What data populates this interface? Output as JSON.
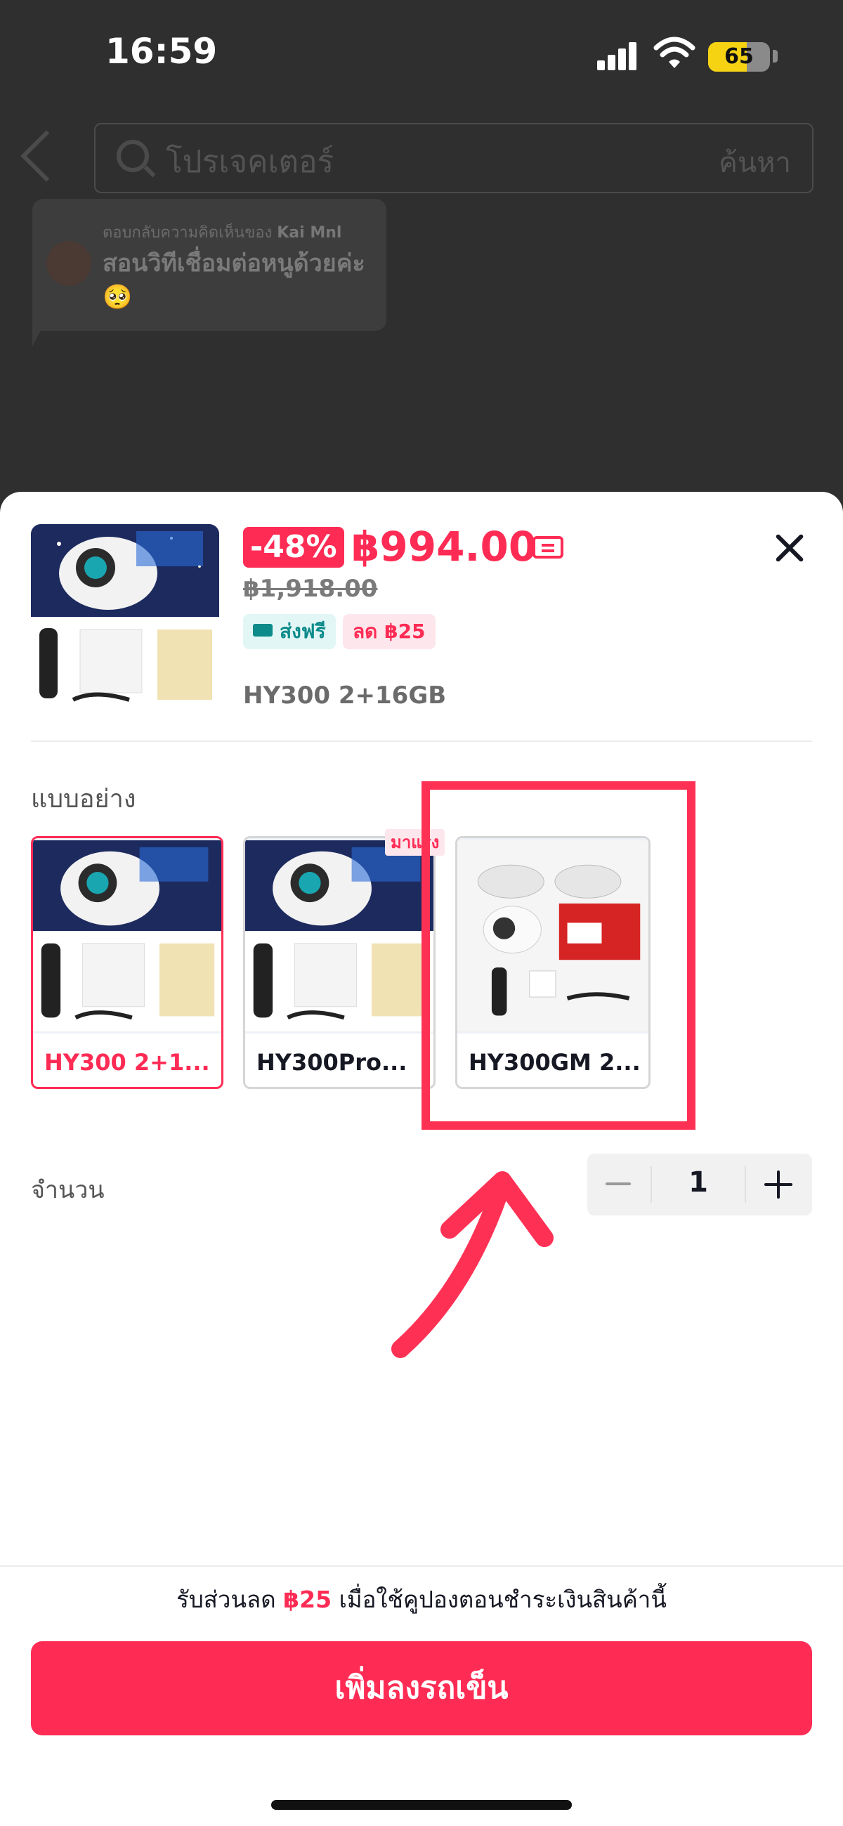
{
  "status_bar": {
    "time": "16:59",
    "battery": "65"
  },
  "background": {
    "search_placeholder": "โปรเจคเตอร์",
    "search_button": "ค้นหา",
    "reply_prefix": "ตอบกลับความคิดเห็นของ",
    "reply_user": "Kai Mnl",
    "reply_text": "สอนวิทีเชื่อมต่อหนูด้วยค่ะ🥺"
  },
  "product": {
    "discount": "-48%",
    "price": "฿994.00",
    "original_price": "฿1,918.00",
    "tags": {
      "free_shipping": "ส่งฟรี",
      "discount": "ลด ฿25"
    },
    "selected_variant": "HY300 2+16GB"
  },
  "variants": {
    "label": "แบบอย่าง",
    "items": [
      {
        "label": "HY300 2+1..."
      },
      {
        "label": "HY300Pro...",
        "tag": "มาแรง"
      },
      {
        "label": "HY300GM 2..."
      }
    ]
  },
  "quantity": {
    "label": "จำนวน",
    "value": "1"
  },
  "footer": {
    "promo_prefix": "รับส่วนลด",
    "promo_amount": "฿25",
    "promo_suffix": "เมื่อใช้คูปองตอนชำระเงินสินค้านี้",
    "cart_button": "เพิ่มลงรถเข็น"
  },
  "colors": {
    "accent": "#fe2c55",
    "annotation": "#fe3155",
    "overlay": "#2f2f2f"
  }
}
